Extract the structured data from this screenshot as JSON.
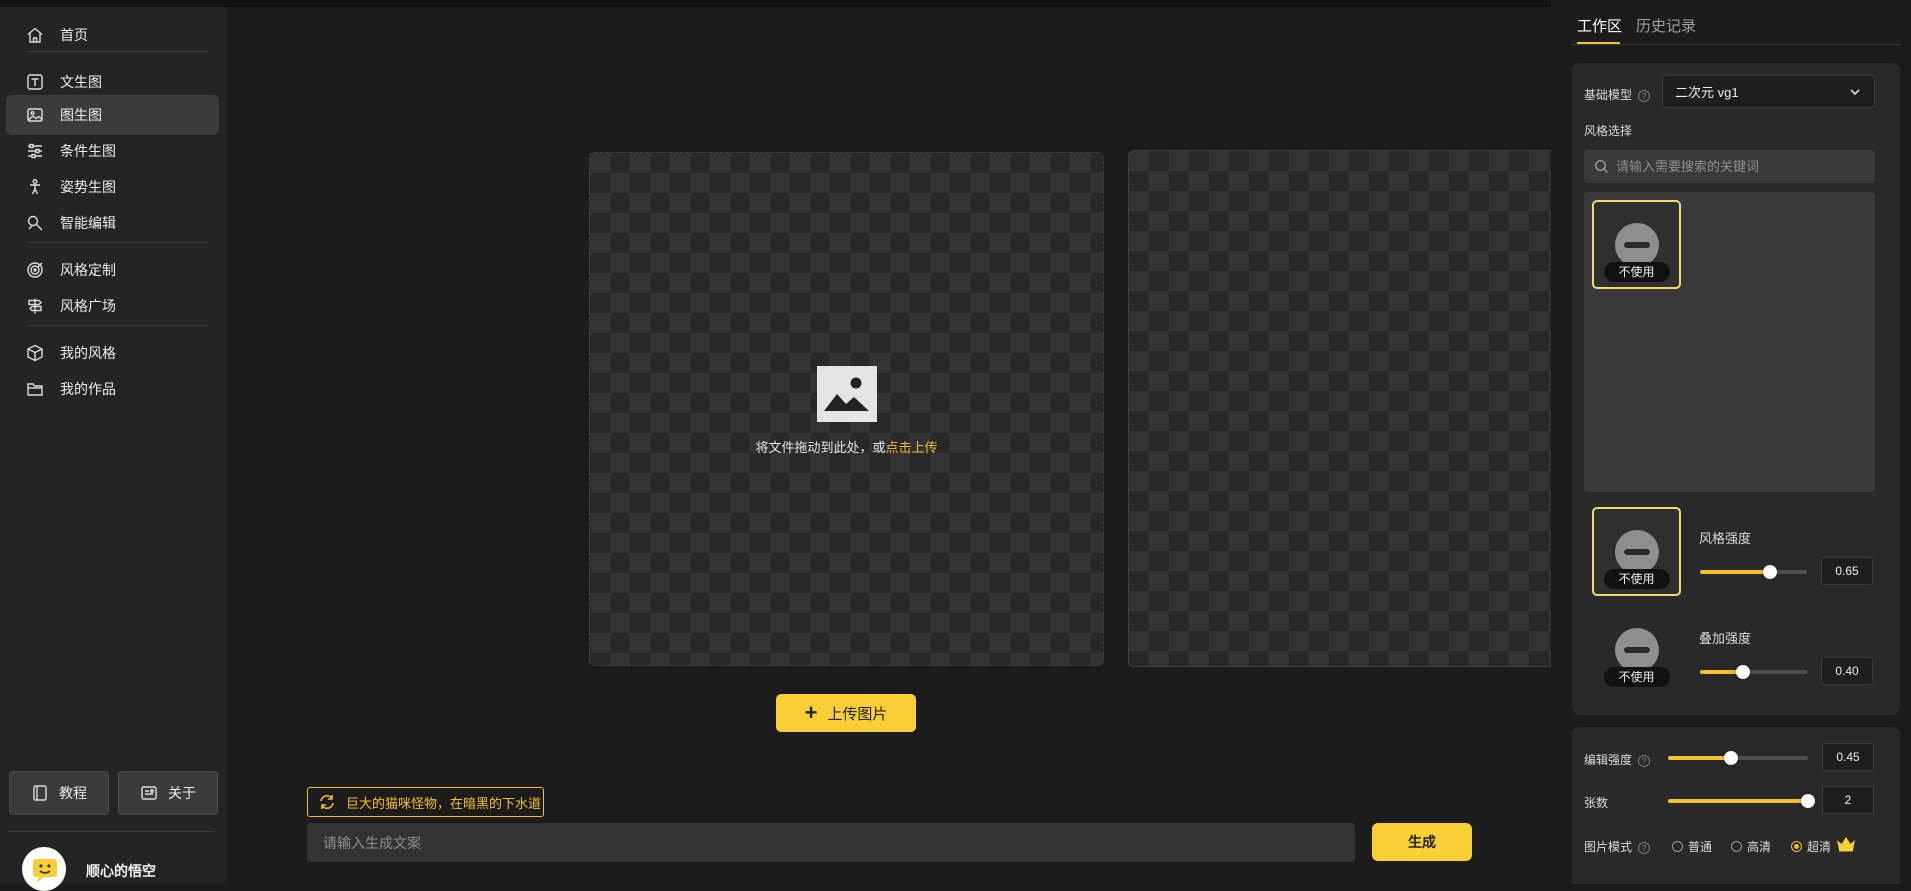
{
  "sidebar": {
    "items": [
      {
        "label": "首页",
        "icon": "home-icon"
      },
      {
        "label": "文生图",
        "icon": "text-t-icon"
      },
      {
        "label": "图生图",
        "icon": "image-icon",
        "active": true
      },
      {
        "label": "条件生图",
        "icon": "sliders-icon"
      },
      {
        "label": "姿势生图",
        "icon": "pose-figure-icon"
      },
      {
        "label": "智能编辑",
        "icon": "magic-edit-icon"
      },
      {
        "label": "风格定制",
        "icon": "target-icon"
      },
      {
        "label": "风格广场",
        "icon": "signpost-icon"
      },
      {
        "label": "我的风格",
        "icon": "cube-icon"
      },
      {
        "label": "我的作品",
        "icon": "folder-icon"
      }
    ],
    "tutorial_label": "教程",
    "about_label": "关于",
    "username": "顺心的悟空"
  },
  "canvas": {
    "drop_text": "将文件拖动到此处，或",
    "drop_link": "点击上传",
    "upload_label": "上传图片"
  },
  "prompt": {
    "suggestion": "巨大的猫咪怪物，在暗黑的下水道",
    "placeholder": "请输入生成文案",
    "generate_label": "生成"
  },
  "panel": {
    "tabs": [
      {
        "label": "工作区",
        "active": true
      },
      {
        "label": "历史记录",
        "active": false
      }
    ],
    "base_model_label": "基础模型",
    "base_model_value": "二次元 vg1",
    "style_select_label": "风格选择",
    "search_placeholder": "请输入需要搜索的关键词",
    "no_use_label": "不使用",
    "style_strength": {
      "label": "风格强度",
      "value": 0.65,
      "display": "0.65"
    },
    "overlay_strength": {
      "label": "叠加强度",
      "value": 0.4,
      "display": "0.40"
    },
    "edit_strength": {
      "label": "编辑强度",
      "value": 0.45,
      "display": "0.45"
    },
    "count": {
      "label": "张数",
      "value": 2,
      "max": 2,
      "display": "2"
    },
    "image_mode": {
      "label": "图片模式",
      "options": [
        "普通",
        "高清",
        "超清"
      ],
      "selected": "超清"
    }
  },
  "colors": {
    "accent": "#f8cf34",
    "background": "#1c1c1c",
    "sidebar": "#242424",
    "card": "#292929"
  }
}
